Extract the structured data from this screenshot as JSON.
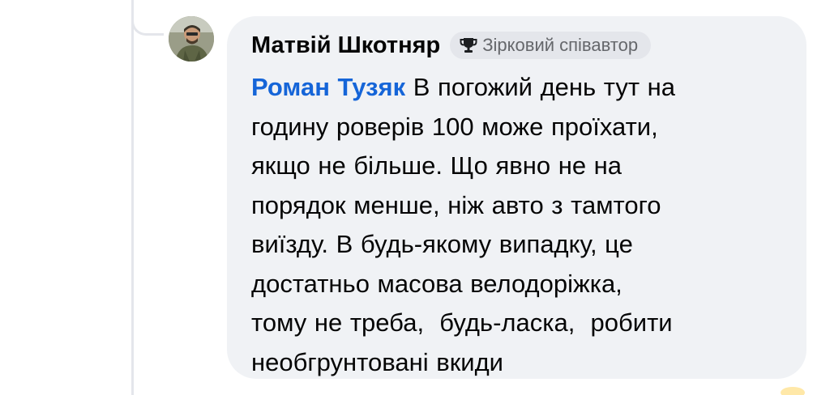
{
  "comment": {
    "author_name": "Матвій Шкотняр",
    "badge_label": "Зірковий співавтор",
    "badge_icon": "trophy-icon",
    "mention": "Роман Тузяк",
    "body_lines": [
      "В погожий день тут на",
      "годину роверів 100 може проїхати,",
      "якщо не більше. Що явно не на",
      "порядок менше, ніж авто з тамтого",
      "виїзду. В будь-якому випадку, це",
      "достатньо масова велодоріжка,",
      "тому не треба,  будь-ласка,  робити",
      "необгрунтовані вкиди"
    ]
  },
  "colors": {
    "bubble_bg": "#f0f2f5",
    "badge_bg": "#e4e6eb",
    "mention": "#1565d8",
    "text": "#050505",
    "muted": "#65676b"
  }
}
